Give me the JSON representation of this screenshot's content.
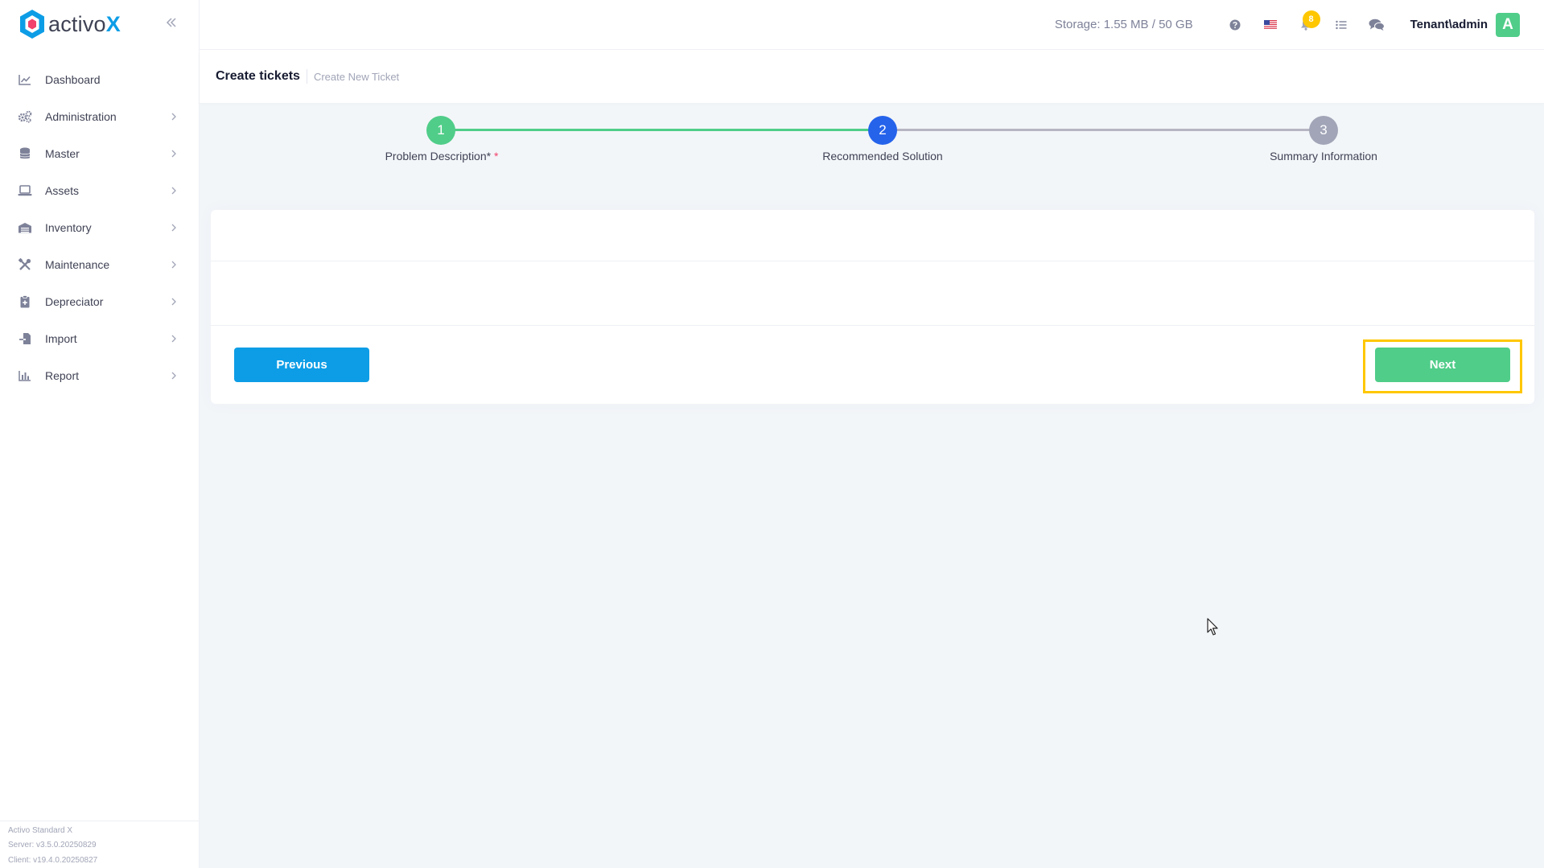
{
  "brand": {
    "name_main": "activo",
    "name_accent": "X"
  },
  "sidebar": {
    "collapse_icon": "double-chevron-left-icon",
    "items": [
      {
        "label": "Dashboard",
        "icon": "chart-line-icon",
        "has_children": false
      },
      {
        "label": "Administration",
        "icon": "gears-icon",
        "has_children": true
      },
      {
        "label": "Master",
        "icon": "database-icon",
        "has_children": true
      },
      {
        "label": "Assets",
        "icon": "laptop-icon",
        "has_children": true
      },
      {
        "label": "Inventory",
        "icon": "warehouse-icon",
        "has_children": true
      },
      {
        "label": "Maintenance",
        "icon": "tools-icon",
        "has_children": true
      },
      {
        "label": "Depreciator",
        "icon": "clipboard-icon",
        "has_children": true
      },
      {
        "label": "Import",
        "icon": "file-import-icon",
        "has_children": true
      },
      {
        "label": "Report",
        "icon": "chart-bar-icon",
        "has_children": true
      }
    ],
    "footer": {
      "product": "Activo Standard X",
      "server": "Server: v3.5.0.20250829",
      "client": "Client: v19.4.0.20250827"
    }
  },
  "header": {
    "storage": "Storage: 1.55 MB / 50 GB",
    "notifications_count": "8",
    "user": "Tenant\\admin",
    "avatar_initial": "A",
    "icons": [
      "help-icon",
      "us-flag-icon",
      "bell-icon",
      "tasks-icon",
      "chat-icon"
    ]
  },
  "page": {
    "title": "Create tickets",
    "subtitle": "Create New Ticket"
  },
  "stepper": {
    "steps": [
      {
        "number": "1",
        "label": "Problem Description*",
        "required_mark": "*",
        "state": "completed"
      },
      {
        "number": "2",
        "label": "Recommended Solution",
        "state": "active"
      },
      {
        "number": "3",
        "label": "Summary Information",
        "state": "pending"
      }
    ]
  },
  "actions": {
    "previous_label": "Previous",
    "next_label": "Next"
  },
  "colors": {
    "primary": "#0d9de6",
    "success": "#50cd89",
    "active_step": "#2563eb",
    "pending_step": "#a1a5b7",
    "highlight": "#ffc700"
  }
}
